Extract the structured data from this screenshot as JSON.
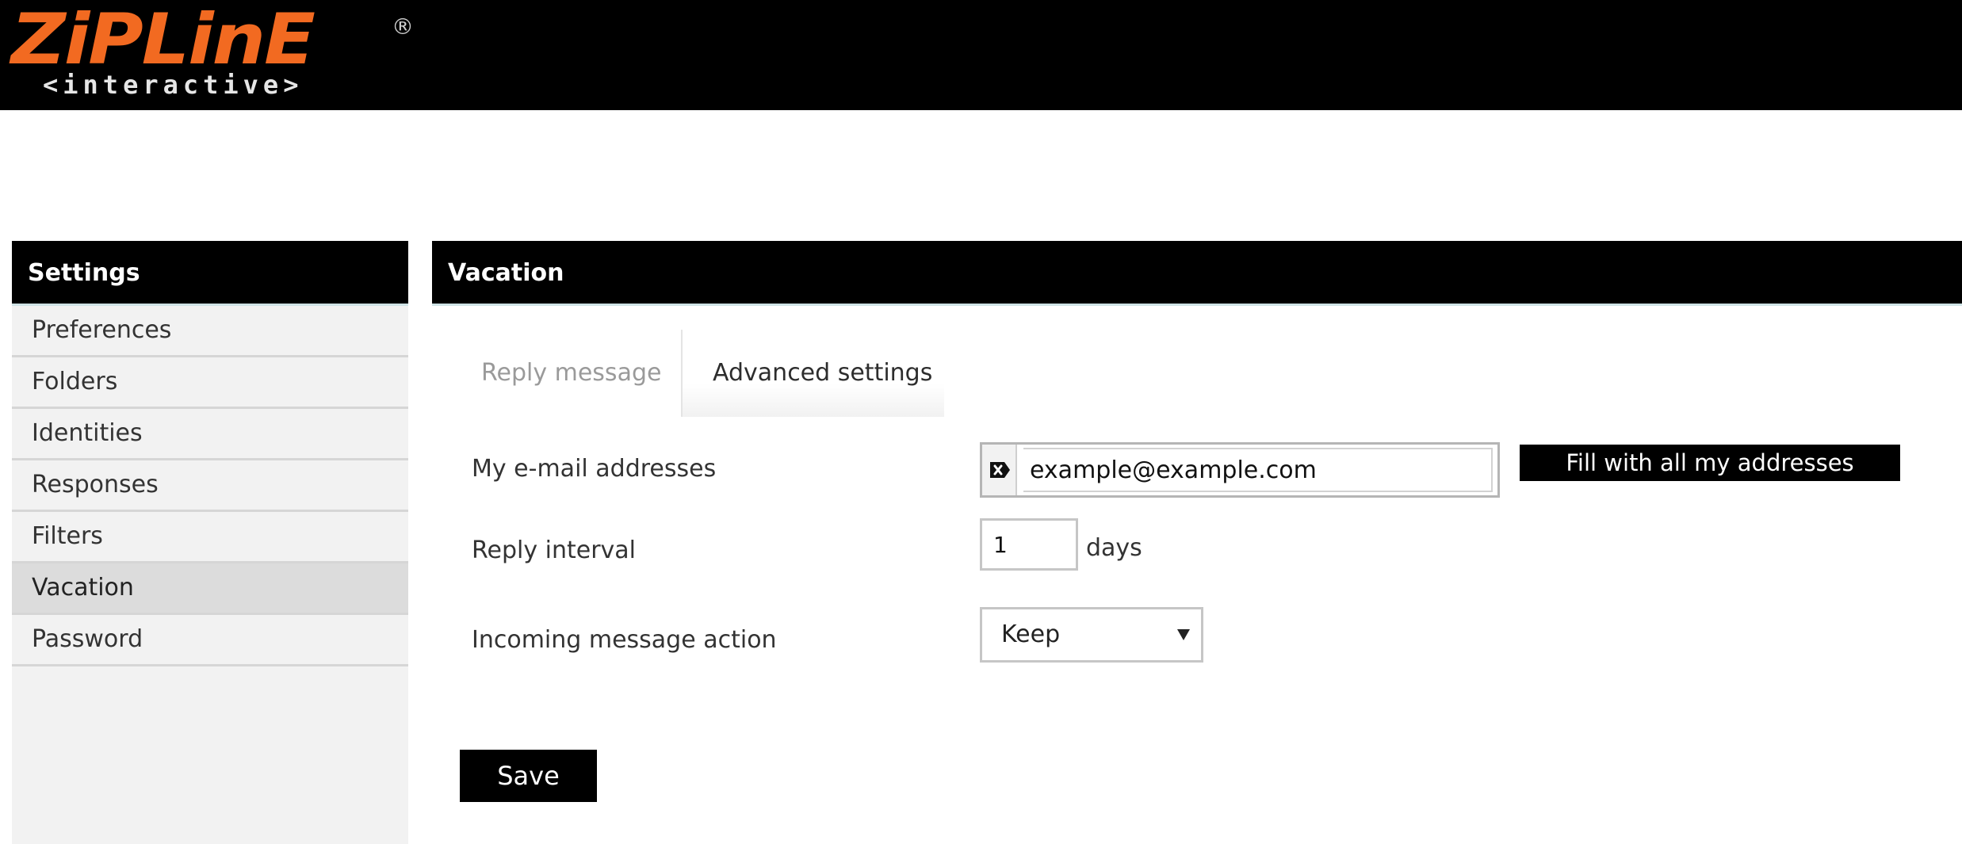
{
  "brand": {
    "name": "ZiPLinE",
    "registered_mark": "®",
    "tagline": "<interactive>",
    "accent_color": "#f26a21"
  },
  "sidebar": {
    "title": "Settings",
    "items": [
      {
        "label": "Preferences",
        "selected": false
      },
      {
        "label": "Folders",
        "selected": false
      },
      {
        "label": "Identities",
        "selected": false
      },
      {
        "label": "Responses",
        "selected": false
      },
      {
        "label": "Filters",
        "selected": false
      },
      {
        "label": "Vacation",
        "selected": true
      },
      {
        "label": "Password",
        "selected": false
      }
    ]
  },
  "main": {
    "title": "Vacation",
    "tabs": [
      {
        "label": "Reply message",
        "active": false
      },
      {
        "label": "Advanced settings",
        "active": true
      }
    ],
    "form": {
      "addresses": {
        "label": "My e-mail addresses",
        "value": "example@example.com",
        "icon": "delete-address-icon"
      },
      "fill_button": "Fill with all my addresses",
      "interval": {
        "label": "Reply interval",
        "value": "1",
        "unit": "days"
      },
      "action": {
        "label": "Incoming message action",
        "selected": "Keep"
      },
      "save_label": "Save"
    }
  }
}
